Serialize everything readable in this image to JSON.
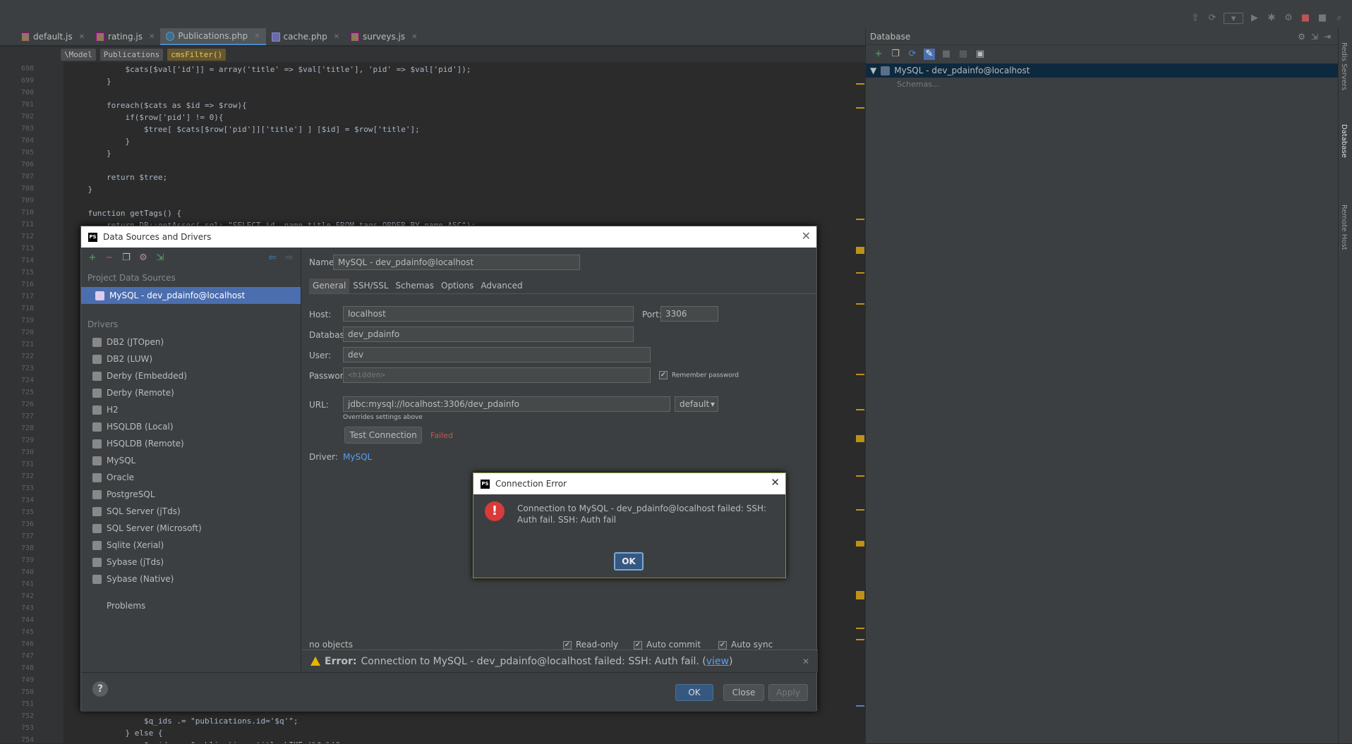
{
  "tabs": [
    {
      "label": "default.js",
      "icon": "js-file-icon"
    },
    {
      "label": "rating.js",
      "icon": "js-file-icon"
    },
    {
      "label": "Publications.php",
      "icon": "php-class-icon",
      "active": true
    },
    {
      "label": "cache.php",
      "icon": "php-file-icon"
    },
    {
      "label": "surveys.js",
      "icon": "js-file-icon"
    }
  ],
  "breadcrumbs": [
    "\\Model",
    "Publications",
    "cmsFilter()"
  ],
  "code": {
    "line_numbers": [
      "698",
      "699",
      "700",
      "701",
      "702",
      "703",
      "704",
      "705",
      "706",
      "707",
      "708",
      "709",
      "710",
      "711",
      "712",
      "713",
      "714",
      "715",
      "716",
      "717",
      "718",
      "719",
      "720",
      "721",
      "722",
      "723",
      "724",
      "725",
      "726",
      "727",
      "728",
      "729",
      "730",
      "731",
      "732",
      "733",
      "734",
      "735",
      "736",
      "737",
      "738",
      "739",
      "740",
      "741",
      "742",
      "743",
      "744",
      "745",
      "746",
      "747",
      "748",
      "749",
      "750",
      "751",
      "752",
      "753",
      "754"
    ],
    "lines_top": [
      "            $cats[$val['id']] = array('title' => $val['title'], 'pid' => $val['pid']);",
      "        }",
      "",
      "        foreach($cats as $id => $row){",
      "            if($row['pid'] != 0){",
      "                $tree[ $cats[$row['pid']]['title'] ] [$id] = $row['title'];",
      "            }",
      "        }",
      "",
      "        return $tree;",
      "    }",
      "",
      "    function getTags() {",
      "        return DB::getAssoc( sql: \"SELECT id, name title FROM tags ORDER BY name ASC\");"
    ],
    "lines_bottom": [
      "                $q_ids .= \"publications.id='$q'\";",
      "            } else {",
      "                $q_ids .= \"publications.title LIKE '%$q%'\";"
    ]
  },
  "db_panel": {
    "title": "Database",
    "connection": "MySQL - dev_pdainfo@localhost",
    "schemas_placeholder": "Schemas..."
  },
  "side_tabs": [
    "Redis Servers",
    "Database",
    "Remote Host"
  ],
  "dialog": {
    "title": "Data Sources and Drivers",
    "project_sources_label": "Project Data Sources",
    "selected_source": "MySQL - dev_pdainfo@localhost",
    "drivers_label": "Drivers",
    "drivers": [
      "DB2 (JTOpen)",
      "DB2 (LUW)",
      "Derby (Embedded)",
      "Derby (Remote)",
      "H2",
      "HSQLDB (Local)",
      "HSQLDB (Remote)",
      "MySQL",
      "Oracle",
      "PostgreSQL",
      "SQL Server (jTds)",
      "SQL Server (Microsoft)",
      "Sqlite (Xerial)",
      "Sybase (jTds)",
      "Sybase (Native)"
    ],
    "problems_label": "Problems",
    "name_label": "Name:",
    "name_value": "MySQL - dev_pdainfo@localhost",
    "tabs": [
      "General",
      "SSH/SSL",
      "Schemas",
      "Options",
      "Advanced"
    ],
    "host_label": "Host:",
    "host_value": "localhost",
    "port_label": "Port:",
    "port_value": "3306",
    "database_label": "Database:",
    "database_value": "dev_pdainfo",
    "user_label": "User:",
    "user_value": "dev",
    "password_label": "Password:",
    "password_placeholder": "<hidden>",
    "remember_password": "Remember password",
    "url_label": "URL:",
    "url_value": "jdbc:mysql://localhost:3306/dev_pdainfo",
    "url_mode": "default",
    "url_hint": "Overrides settings above",
    "test_connection": "Test Connection",
    "test_status": "Failed",
    "driver_label": "Driver:",
    "driver_value": "MySQL",
    "objects_status": "no objects",
    "readonly": "Read-only",
    "autocommit": "Auto commit",
    "autosync": "Auto sync",
    "error_prefix": "Error:",
    "error_text": "Connection to MySQL - dev_pdainfo@localhost failed: SSH: Auth fail. (",
    "error_link": "view",
    "error_suffix": ")",
    "ok": "OK",
    "close": "Close",
    "apply": "Apply"
  },
  "error_dialog": {
    "title": "Connection Error",
    "message": "Connection to MySQL - dev_pdainfo@localhost failed: SSH: Auth fail. SSH: Auth fail",
    "ok": "OK"
  },
  "colors": {
    "bg": "#2b2b2b",
    "panel": "#3c3f41",
    "selection": "#4b6eaf",
    "error_red": "#d93a3a",
    "link": "#589df6"
  }
}
